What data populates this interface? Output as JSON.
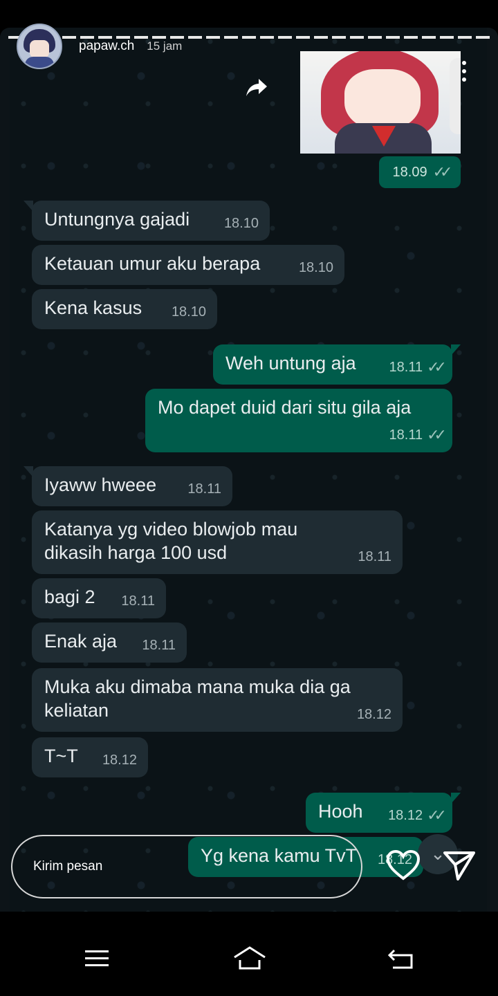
{
  "story": {
    "username": "papaw.ch",
    "time_ago": "15 jam",
    "reply_placeholder": "Kirim pesan"
  },
  "chat": {
    "image_message_time": "18.09",
    "messages": [
      {
        "dir": "in",
        "text": "Untungnya gajadi",
        "time": "18.10"
      },
      {
        "dir": "in",
        "text": "Ketauan umur aku berapa",
        "time": "18.10"
      },
      {
        "dir": "in",
        "text": "Kena kasus",
        "time": "18.10"
      },
      {
        "dir": "out",
        "text": "Weh untung aja",
        "time": "18.11"
      },
      {
        "dir": "out",
        "text": "Mo dapet duid dari situ gila aja",
        "time": "18.11"
      },
      {
        "dir": "in",
        "text": "Iyaww hweee",
        "time": "18.11"
      },
      {
        "dir": "in",
        "text": "Katanya yg video blowjob mau dikasih harga 100 usd",
        "time": "18.11"
      },
      {
        "dir": "in",
        "text": "bagi 2",
        "time": "18.11"
      },
      {
        "dir": "in",
        "text": "Enak aja",
        "time": "18.11"
      },
      {
        "dir": "in",
        "text": "Muka aku dimaba mana muka dia ga keliatan",
        "time": "18.12"
      },
      {
        "dir": "in",
        "text": "T~T",
        "time": "18.12"
      },
      {
        "dir": "out",
        "text": "Hooh",
        "time": "18.12"
      },
      {
        "dir": "out",
        "text": "Yg kena kamu TvT",
        "time": "18.12"
      }
    ]
  },
  "icons": {
    "share": "share-arrow-icon",
    "more": "more-vertical-icon",
    "like": "heart-icon",
    "send": "send-icon",
    "nav_menu": "menu-icon",
    "nav_home": "home-icon",
    "nav_back": "back-icon"
  },
  "colors": {
    "incoming_bubble": "#1f2c33",
    "outgoing_bubble": "#005c4b",
    "chat_background": "#0b1317"
  }
}
